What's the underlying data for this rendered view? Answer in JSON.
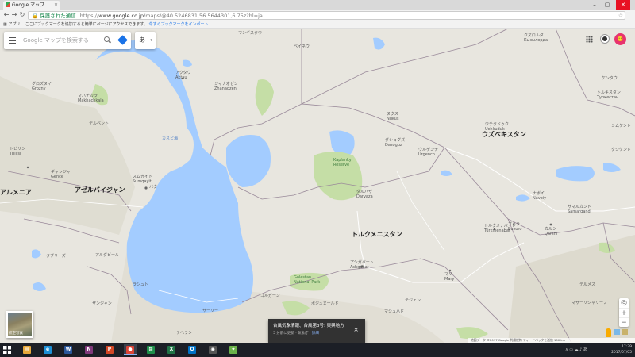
{
  "browser": {
    "tab_title": "Google マップ",
    "tab_close": "×",
    "window_controls": {
      "minimize": "–",
      "maximize": "▢",
      "close": "✕"
    },
    "nav": {
      "back": "←",
      "forward": "→",
      "reload": "↻"
    },
    "secure_label": "保護された通信",
    "url_scheme": "https://",
    "url_host": "www.google.co.jp",
    "url_path": "/maps/@40.5246831,56.5644301,6.75z?hl=ja",
    "star": "☆"
  },
  "bookmarks": {
    "apps_label": "アプリ",
    "hint": "ここにブックマークを追加すると簡単にページにアクセスできます。",
    "import_link": "今すぐブックマークをインポート..."
  },
  "search": {
    "placeholder": "Google マップを検索する",
    "ime_label": "あ",
    "ime_caret": "▾"
  },
  "account": {
    "avatar_text": "🙂"
  },
  "map_labels": {
    "uzbekistan": "ウズベキスタン",
    "turkmenistan": "トルクメニスタン",
    "azerbaijan": "アゼルバイジャン",
    "armenia": "アルメニア",
    "caspian": "カスピ海",
    "baku": "バクー",
    "baku_en": "Baku",
    "ashgabat": "アシガバート",
    "ashgabat_en": "Ashgabat",
    "aktau": "アクタウ",
    "aktau_en": "Aktau",
    "janaozen": "ジャナオゼン",
    "janaozen_en": "Zhanaozen",
    "makhachkala": "マハチカラ",
    "makhachkala_en": "Makhachkala",
    "grozny": "グロズヌイ",
    "grozny_en": "Grozny",
    "derbent": "デルベント",
    "tbilisi": "トビリシ",
    "tbilisi_en": "Tbilisi",
    "ganja": "ギャンジャ",
    "ganja_en": "Gence",
    "sumgait": "スムガイト",
    "sumgait_en": "Sumqayit",
    "nukus": "ヌクス",
    "nukus_en": "Nukus",
    "dashoguz": "ダショグズ",
    "dashoguz_en": "Dasoguz",
    "urgench": "ウルゲンチ",
    "urgench_en": "Urgench",
    "uchkuduk": "ウチクドゥク",
    "uchkuduk_en": "Uchkuduk",
    "navoi": "ナボイ",
    "navoi_en": "Navoiy",
    "samarkand": "サマルカンド",
    "samarkand_en": "Samarqand",
    "bukhara": "ブハラ",
    "bukhara_en": "Buxoro",
    "turkmenabat": "トルクメナバート",
    "turkmenabat_en": "Türkmenabat",
    "mary": "マリ",
    "mary_en": "Mary",
    "karshi": "カルシ",
    "karshi_en": "Qarshi",
    "darvaza": "ダルバザ",
    "darvaza_en": "Darvaza",
    "kaplankyr": "Kaplankyr Reserve",
    "golestan": "Golestan National Park",
    "tashkent": "タシケント",
    "shymkent": "シムケント",
    "turkestan": "トルキスタン",
    "turkestan_en": "Туркестан",
    "kentau": "ケンタウ",
    "termez": "テルメズ",
    "mazar": "マザーリシャリーフ",
    "tabriz": "タブリーズ",
    "ardabil": "アルダビール",
    "rasht": "ラシュト",
    "zanjan": "ザンジャン",
    "sari": "サーリー",
    "tehran": "テヘラン",
    "mashhad": "マシュハド",
    "gorgan": "ゴルガーン",
    "bojnurd": "ボジュヌールド",
    "kyzylorda": "クズロルダ",
    "kyzylorda_en": "Кызылорда",
    "mangystau": "マンギスタウ",
    "beyneu": "ベイネウ",
    "tedzhen": "テジェン"
  },
  "satellite_thumb": {
    "label": "航空写真"
  },
  "zoom": {
    "in": "+",
    "out": "−",
    "locate": "◎"
  },
  "toast": {
    "title": "台風気象情報、台風第3号: 東興地方",
    "sub": "5 分前に更新 · 気象庁 ·",
    "link": "詳細",
    "close": "×"
  },
  "footer": {
    "text": "地図データ ©2017 Google  利用規約  フィードバックを送信  100 km"
  },
  "taskbar": {
    "apps": [
      {
        "name": "file-explorer",
        "color": "#e8a93b",
        "glyph": "▤"
      },
      {
        "name": "ie",
        "color": "#1e90d6",
        "glyph": "e"
      },
      {
        "name": "word",
        "color": "#2b579a",
        "glyph": "W"
      },
      {
        "name": "onenote",
        "color": "#80397b",
        "glyph": "N"
      },
      {
        "name": "powerpoint",
        "color": "#d24726",
        "glyph": "P"
      },
      {
        "name": "chrome",
        "color": "#db4437",
        "glyph": "●"
      },
      {
        "name": "store",
        "color": "#1e8f4a",
        "glyph": "⊞"
      },
      {
        "name": "excel",
        "color": "#217346",
        "glyph": "X"
      },
      {
        "name": "outlook",
        "color": "#0072c6",
        "glyph": "O"
      },
      {
        "name": "camera",
        "color": "#555",
        "glyph": "◉"
      },
      {
        "name": "maps-app",
        "color": "#6bb24a",
        "glyph": "⌖"
      }
    ],
    "tray_icons": "∧  ▭  ☁  ♪  あ",
    "time": "17:39",
    "date": "2017/07/05"
  },
  "colors": {
    "water": "#a3ccff",
    "land": "#e8e6df",
    "green": "#c5dea6",
    "border": "#9a8a9a",
    "accent": "#1a73e8"
  }
}
